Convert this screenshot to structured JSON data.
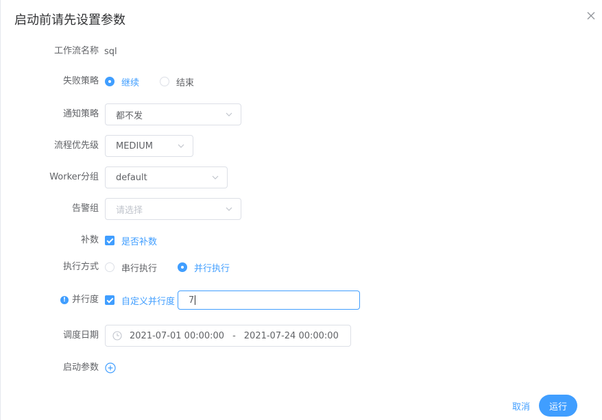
{
  "dialog": {
    "title": "启动前请先设置参数"
  },
  "form": {
    "workflow_name": {
      "label": "工作流名称",
      "value": "sql"
    },
    "failure_strategy": {
      "label": "失败策略",
      "options": [
        "继续",
        "结束"
      ],
      "selected": "继续"
    },
    "notify_strategy": {
      "label": "通知策略",
      "value": "都不发"
    },
    "priority": {
      "label": "流程优先级",
      "value": "MEDIUM"
    },
    "worker_group": {
      "label": "Worker分组",
      "value": "default"
    },
    "alert_group": {
      "label": "告警组",
      "placeholder": "请选择"
    },
    "complement": {
      "label": "补数",
      "checkbox_label": "是否补数",
      "checked": true
    },
    "exec_mode": {
      "label": "执行方式",
      "options": [
        "串行执行",
        "并行执行"
      ],
      "selected": "并行执行"
    },
    "parallelism": {
      "label": "并行度",
      "checkbox_label": "自定义并行度",
      "checked": true,
      "value": "7"
    },
    "schedule_date": {
      "label": "调度日期",
      "start": "2021-07-01 00:00:00",
      "separator": "-",
      "end": "2021-07-24 00:00:00"
    },
    "start_params": {
      "label": "启动参数"
    }
  },
  "footer": {
    "cancel_label": "取消",
    "run_label": "运行"
  },
  "colors": {
    "accent": "#409eff",
    "text": "#606266",
    "border": "#dcdfe6",
    "placeholder": "#c0c4cc"
  },
  "icons": [
    "close-icon",
    "chevron-down-icon",
    "clock-icon",
    "plus-circle-icon",
    "info-icon"
  ]
}
